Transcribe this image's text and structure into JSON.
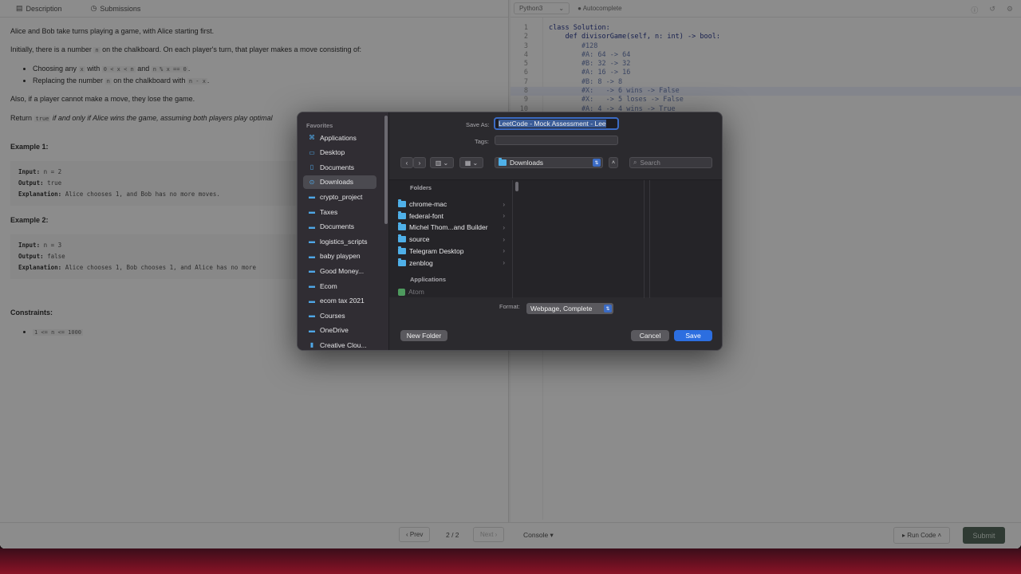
{
  "desc_tabs": {
    "description": "Description",
    "submissions": "Submissions"
  },
  "problem": {
    "p1": "Alice and Bob take turns playing a game, with Alice starting first.",
    "p2a": "Initially, there is a number ",
    "p2_code": "n",
    "p2b": " on the chalkboard. On each player's turn, that player makes a move consisting of:",
    "b1a": "Choosing any ",
    "b1_code1": "x",
    "b1b": " with ",
    "b1_code2": "0 < x < n",
    "b1c": " and ",
    "b1_code3": "n % x == 0",
    "b1d": ".",
    "b2a": "Replacing the number ",
    "b2_code1": "n",
    "b2b": " on the chalkboard with ",
    "b2_code2": "n - x",
    "b2c": ".",
    "p3": "Also, if a player cannot make a move, they lose the game.",
    "p4a": "Return ",
    "p4_code": "true",
    "p4b": " if and only if Alice wins the game, assuming both players play optimal",
    "ex1_title": "Example 1:",
    "ex1_input_label": "Input:",
    "ex1_input": " n = 2",
    "ex1_output_label": "Output:",
    "ex1_output": " true",
    "ex1_expl_label": "Explanation:",
    "ex1_expl": " Alice chooses 1, and Bob has no more moves.",
    "ex2_title": "Example 2:",
    "ex2_input_label": "Input:",
    "ex2_input": " n = 3",
    "ex2_output_label": "Output:",
    "ex2_output": " false",
    "ex2_expl_label": "Explanation:",
    "ex2_expl": " Alice chooses 1, Bob chooses 1, and Alice has no more",
    "constraints_title": "Constraints:",
    "constraint1": "1 <= n <= 1000"
  },
  "editor": {
    "language": "Python3",
    "autocomplete": "Autocomplete",
    "lines": [
      {
        "n": "1",
        "text": "class Solution:"
      },
      {
        "n": "2",
        "text": "    def divisorGame(self, n: int) -> bool:"
      },
      {
        "n": "3",
        "text": "        #128"
      },
      {
        "n": "4",
        "text": "        #A: 64 -> 64"
      },
      {
        "n": "5",
        "text": "        #B: 32 -> 32"
      },
      {
        "n": "6",
        "text": "        #A: 16 -> 16"
      },
      {
        "n": "7",
        "text": "        #B: 8 -> 8"
      },
      {
        "n": "8",
        "text": "        #X:   -> 6 wins -> False"
      },
      {
        "n": "9",
        "text": "        #X:   -> 5 loses -> False"
      },
      {
        "n": "10",
        "text": "        #A: 4 -> 4 wins -> True"
      }
    ]
  },
  "bottom": {
    "prev": "‹ Prev",
    "page": "2 / 2",
    "next": "Next ›",
    "console": "Console ▾",
    "run": "▸ Run Code ˄",
    "submit": "Submit"
  },
  "dialog": {
    "favorites_header": "Favorites",
    "sidebar_items": [
      {
        "label": "Applications",
        "icon": "applications-icon"
      },
      {
        "label": "Desktop",
        "icon": "desktop-icon"
      },
      {
        "label": "Documents",
        "icon": "document-icon"
      },
      {
        "label": "Downloads",
        "icon": "downloads-icon"
      },
      {
        "label": "crypto_project",
        "icon": "folder-icon"
      },
      {
        "label": "Taxes",
        "icon": "folder-icon"
      },
      {
        "label": "Documents",
        "icon": "folder-icon"
      },
      {
        "label": "logistics_scripts",
        "icon": "folder-icon"
      },
      {
        "label": "baby playpen",
        "icon": "folder-icon"
      },
      {
        "label": "Good Money...",
        "icon": "folder-icon"
      },
      {
        "label": "Ecom",
        "icon": "folder-icon"
      },
      {
        "label": "ecom tax 2021",
        "icon": "folder-icon"
      },
      {
        "label": "Courses",
        "icon": "folder-icon"
      },
      {
        "label": "OneDrive",
        "icon": "folder-icon"
      },
      {
        "label": "Creative Clou...",
        "icon": "file-icon"
      }
    ],
    "save_as_label": "Save As:",
    "save_as_value": "LeetCode - Mock Assessment - Lee",
    "tags_label": "Tags:",
    "location": "Downloads",
    "search_placeholder": "Search",
    "folders_header": "Folders",
    "folders": [
      "chrome-mac",
      "federal-font",
      "Michel Thom...and Builder",
      "source",
      "Telegram Desktop",
      "zenblog"
    ],
    "applications_header": "Applications",
    "applications": [
      "Atom"
    ],
    "format_label": "Format:",
    "format_value": "Webpage, Complete",
    "new_folder": "New Folder",
    "cancel": "Cancel",
    "save": "Save",
    "colors": {
      "accent": "#2c6ee0",
      "folder": "#4fb0e8"
    }
  }
}
